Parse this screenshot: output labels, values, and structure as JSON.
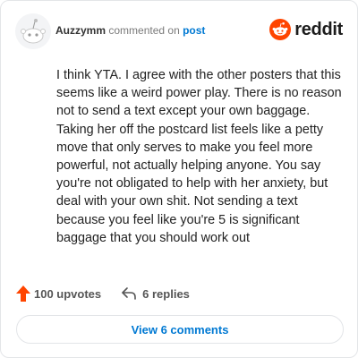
{
  "header": {
    "username": "Auzzymm",
    "commented_on_text": "commented on",
    "post_link": "post",
    "brand_name": "reddit",
    "brand_icon": "reddit-logo-icon",
    "avatar_icon": "snoo-avatar-icon"
  },
  "comment": {
    "body": "I think YTA. I agree with the other posters that this seems like a weird power play. There is no reason not to send a text except your own baggage. Taking her off the postcard list feels like a petty move that only serves to make you feel more powerful, not actually helping anyone. You say you're not obligated to help with her anxiety, but deal with your own shit. Not sending a text because you feel like you're 5 is significant baggage that you should work out"
  },
  "actions": {
    "upvotes": "100 upvotes",
    "replies": "6 replies",
    "upvote_icon": "upvote-arrow-icon",
    "reply_icon": "reply-icon"
  },
  "footer": {
    "view_comments": "View 6 comments"
  },
  "colors": {
    "brand_orange": "#ff4500",
    "link_blue": "#0079d3",
    "upvote_orange": "#ff4500",
    "border": "#e3e5e8"
  }
}
